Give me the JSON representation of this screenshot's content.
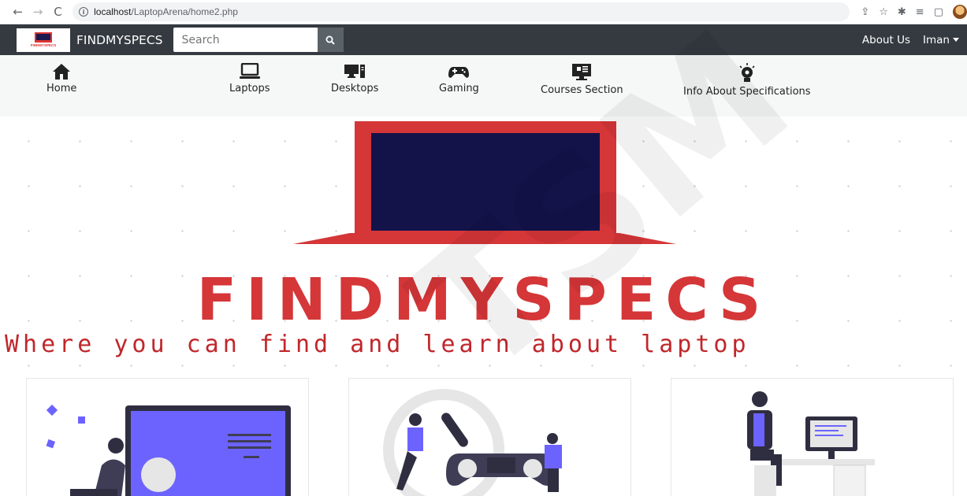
{
  "browser": {
    "url_host": "localhost",
    "url_path": "/LaptopArena/home2.php",
    "back_icon": "arrow-left-icon",
    "forward_icon": "arrow-right-icon",
    "reload_icon": "reload-icon"
  },
  "navbar": {
    "brand": "FINDMYSPECS",
    "logo_text": "FINDMYSPECS",
    "search_placeholder": "Search",
    "about": "About Us",
    "user": "Iman"
  },
  "categories": {
    "home": "Home",
    "laptops": "Laptops",
    "desktops": "Desktops",
    "gaming": "Gaming",
    "courses": "Courses Section",
    "specs": "Info About Specifications"
  },
  "hero": {
    "title": "FINDMYSPECS",
    "tagline": "Where you can find and learn about laptop"
  },
  "watermark": "TSM",
  "colors": {
    "navbar": "#343a40",
    "brand_red": "#d53638",
    "laptop_screen": "#13134a",
    "accent_purple": "#6c63ff"
  }
}
